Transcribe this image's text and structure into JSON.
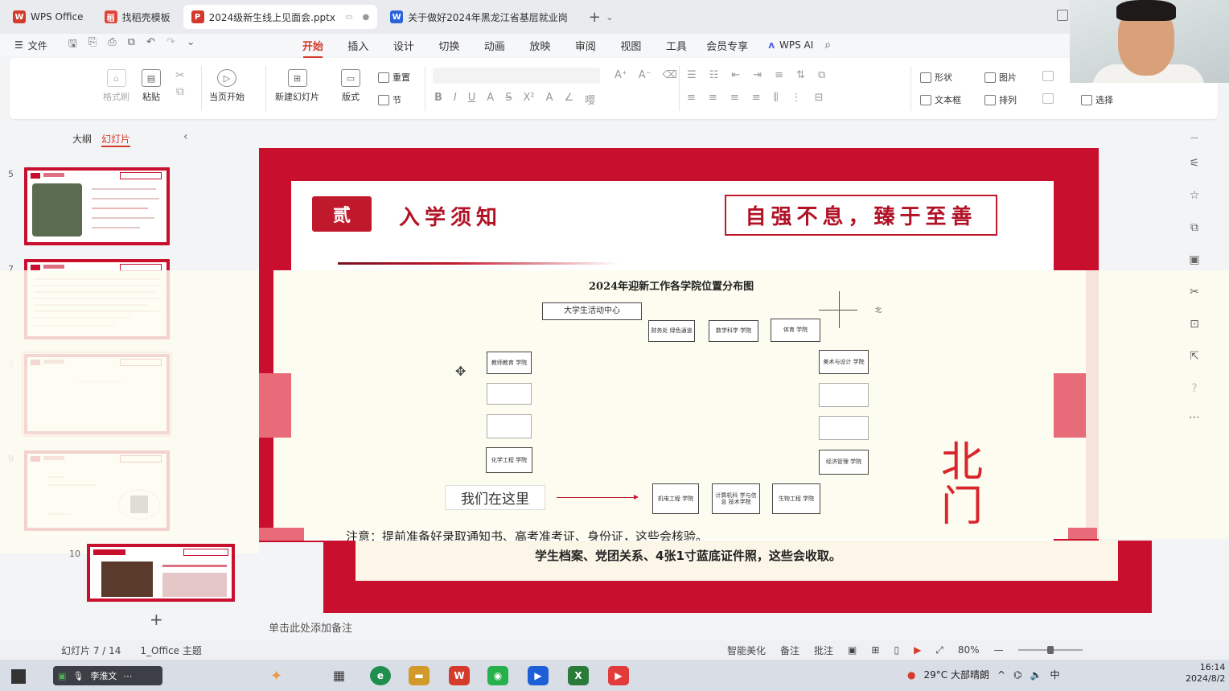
{
  "tabs": [
    {
      "label": "WPS Office",
      "color": "#d43b2a",
      "glyph": "W"
    },
    {
      "label": "找稻壳模板",
      "color": "#e0453a",
      "glyph": "稻"
    },
    {
      "label": "2024级新生线上见面会.pptx",
      "color": "#d4382c",
      "glyph": "P"
    },
    {
      "label": "关于做好2024年黑龙江省基层就业岗",
      "color": "#2c64d8",
      "glyph": "W"
    }
  ],
  "menubar": {
    "file_label": "文件",
    "items": [
      "开始",
      "插入",
      "设计",
      "切换",
      "动画",
      "放映",
      "审阅",
      "视图",
      "工具",
      "会员专享"
    ],
    "active": "开始",
    "ai_label": "WPS AI"
  },
  "ribbon": {
    "format_painter": "格式刷",
    "paste": "粘贴",
    "play_from_current": "当页开始",
    "new_slide": "新建幻灯片",
    "layout": "版式",
    "reset": "重置",
    "section": "节",
    "shape": "形状",
    "picture": "图片",
    "textbox": "文本框",
    "arrange": "排列",
    "select": "选择"
  },
  "leftpanel": {
    "tab_outline": "大纲",
    "tab_slides": "幻灯片",
    "thumb_numbers": [
      "5",
      "7",
      "8",
      "9"
    ],
    "extra_thumb_number": "10"
  },
  "slide": {
    "badge": "贰",
    "title": "入学须知",
    "motto": "自强不息，臻于至善",
    "map_title": "2024年迎新工作各学院位置分布图",
    "north_marker": "北",
    "we_are_here": "我们在这里",
    "north_gate": "北门",
    "note_line1": "注意：提前准备好录取通知书、高考准考证、身份证，这些会核验。",
    "note_line2": "学生档案、党团关系、4张1寸蓝底证件照，这些会收取。",
    "boxes": {
      "center": "大学生活动中心",
      "b1": "财务处 绿色通道",
      "b2": "数学科学 学院",
      "b3": "体育 学院",
      "b4": "教师教育 学院",
      "b5": "美术与设计 学院",
      "b6": "化学工程 学院",
      "b7": "经济管理 学院",
      "b8": "机电工程 学院",
      "b9": "计算机科 学与信息 技术学院",
      "b10": "生物工程 学院"
    }
  },
  "notes_placeholder": "单击此处添加备注",
  "status": {
    "slide_count": "幻灯片 7 / 14",
    "theme": "1_Office 主题",
    "beautify": "智能美化",
    "notes": "备注",
    "comments": "批注",
    "zoom": "80%"
  },
  "taskbar": {
    "input_label": "李淮文",
    "weather": "29°C 大部晴朗",
    "ime": "中",
    "time": "16:14",
    "date": "2024/8/2"
  }
}
